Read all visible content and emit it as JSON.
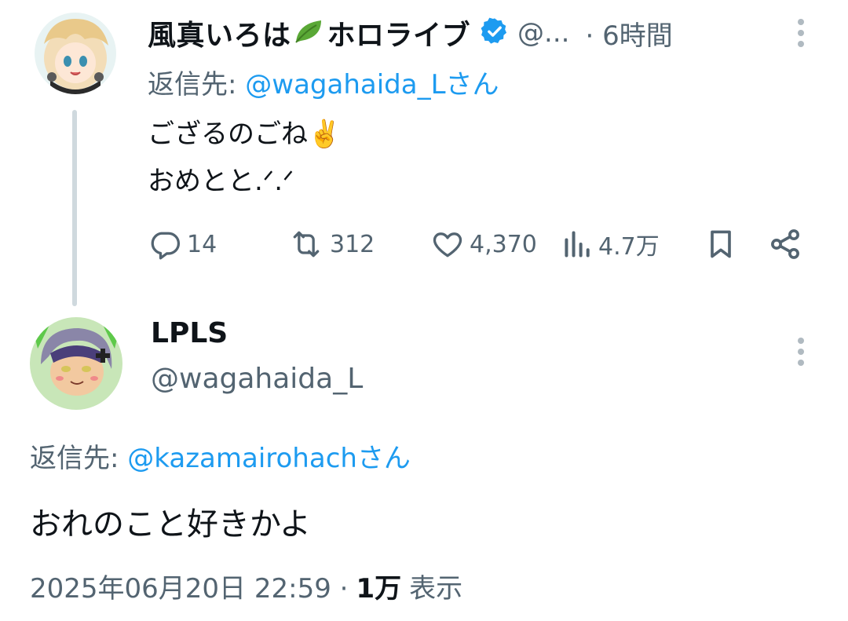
{
  "parent_tweet": {
    "display_name_part1": "風真いろは",
    "display_name_part2": "ホロライブ",
    "handle_truncated": "@...",
    "time": "· 6時間",
    "reply_prefix": "返信先: ",
    "reply_mention": "@wagahaida_L",
    "reply_suffix": "さん",
    "text_lines": [
      "ござるのごね✌️",
      "おめとと.ᐟ.ᐟ"
    ],
    "actions": {
      "replies": "14",
      "retweets": "312",
      "likes": "4,370",
      "views": "4.7万"
    }
  },
  "main_tweet": {
    "display_name": "LPLS",
    "handle": "@wagahaida_L",
    "reply_prefix": "返信先: ",
    "reply_mention": "@kazamairohach",
    "reply_suffix": "さん",
    "text": "おれのこと好きかよ",
    "timestamp": "2025年06月20日 22:59 · ",
    "views_count": "1万",
    "views_label": "表示"
  },
  "colors": {
    "link": "#1d9bf0",
    "muted": "#536471",
    "text": "#0f1419",
    "thread_line": "#cfd9de",
    "verified": "#1d9bf0"
  },
  "icons": [
    "leaf-icon",
    "verified-badge-icon",
    "more-icon",
    "reply-icon",
    "retweet-icon",
    "like-icon",
    "views-icon",
    "bookmark-icon",
    "share-icon"
  ]
}
